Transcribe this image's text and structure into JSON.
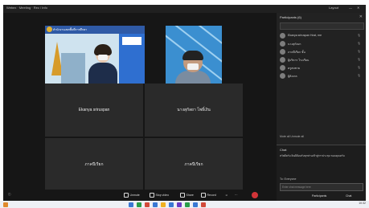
{
  "topbar": {
    "app_title": "Webex  ·  Meeting  ·  Rec / Info",
    "right_label": "Layout"
  },
  "tiles": [
    {
      "name": "Ekanya sriruspan"
    },
    {
      "name": "นางสุกัลยา โพธิ์เงิน"
    },
    {
      "name": "ภาคปีเรียก"
    },
    {
      "name": "ภาคปีเรียก"
    }
  ],
  "share_banner": "สำนักงานเขตพื้นที่การศึกษา",
  "toolbar": {
    "mute": "Unmute",
    "video": "Stop video",
    "share": "Share",
    "record": "Record",
    "more": "···",
    "apps": "Apps"
  },
  "sidebar": {
    "title": "Participants (6)",
    "participants": [
      {
        "name": "Ekanya sriruspan Host, me"
      },
      {
        "name": "นางสุกัลยา"
      },
      {
        "name": "ภาคปีเรียก ชั้น"
      },
      {
        "name": "ผู้บริหาร โรงเรียน"
      },
      {
        "name": "ครูสมชาย"
      },
      {
        "name": "ผู้สังเกต"
      }
    ],
    "links": "Mute all   Unmute all",
    "chat_title": "Chat",
    "chat_message": "สวัสดีครับ ยินดีต้อนรับทุกท่านเข้าสู่การประชุม ขอบคุณครับ",
    "to_label": "To:  Everyone",
    "input_placeholder": "Enter chat message here",
    "participants_btn": "Participants",
    "chat_btn": "Chat"
  },
  "taskbar": {
    "clock": "10:32"
  }
}
